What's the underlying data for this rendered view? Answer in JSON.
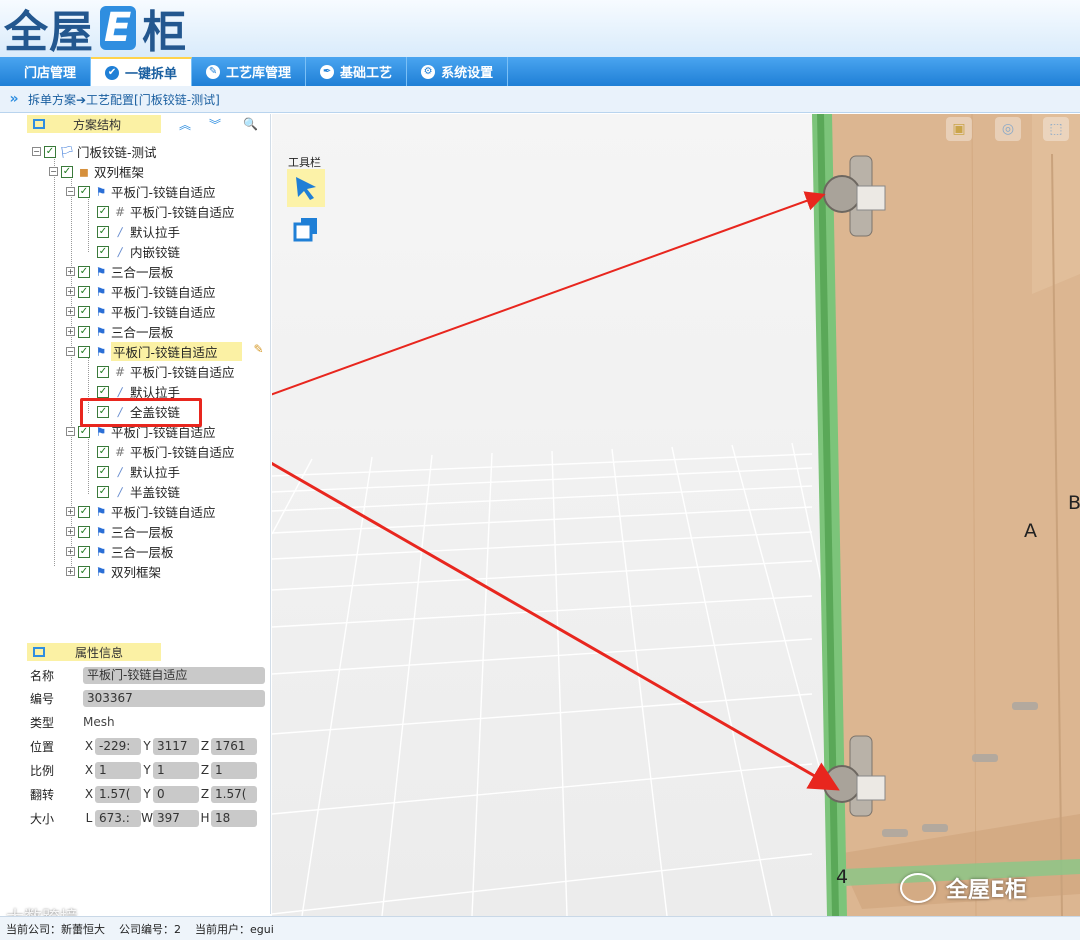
{
  "app": {
    "logo_main": "全屋",
    "logo_e": "E",
    "logo_end": "柜"
  },
  "nav": {
    "tabs": [
      {
        "label": "门店管理",
        "icon": ""
      },
      {
        "label": "一键拆单",
        "icon": "check-circle-icon",
        "active": true
      },
      {
        "label": "工艺库管理",
        "icon": "pencil-icon"
      },
      {
        "label": "基础工艺",
        "icon": "pen-nib-icon"
      },
      {
        "label": "系统设置",
        "icon": "settings-icon"
      }
    ]
  },
  "breadcrumb": {
    "toggle": "»",
    "path": "拆单方案➔工艺配置[门板铰链-测试]"
  },
  "structure_panel": {
    "title": "方案结构"
  },
  "tree": [
    {
      "label": "门板铰链-测试",
      "icon": "flag-icon"
    },
    {
      "label": "双列框架",
      "icon": "box-icon"
    },
    {
      "label": "平板门-铰链自适应",
      "icon": "flag-icon"
    },
    {
      "label": "平板门-铰链自适应",
      "icon": "grid-icon"
    },
    {
      "label": "默认拉手",
      "icon": "handle-icon"
    },
    {
      "label": "内嵌铰链",
      "icon": "hinge-icon"
    },
    {
      "label": "三合一层板",
      "icon": "flag-icon"
    },
    {
      "label": "平板门-铰链自适应",
      "icon": "flag-icon"
    },
    {
      "label": "平板门-铰链自适应",
      "icon": "flag-icon"
    },
    {
      "label": "三合一层板",
      "icon": "flag-icon"
    },
    {
      "label": "平板门-铰链自适应",
      "icon": "flag-icon",
      "selected": true
    },
    {
      "label": "平板门-铰链自适应",
      "icon": "grid-icon"
    },
    {
      "label": "默认拉手",
      "icon": "handle-icon"
    },
    {
      "label": "全盖铰链",
      "icon": "hinge-icon",
      "highlighted": true
    },
    {
      "label": "平板门-铰链自适应",
      "icon": "flag-icon"
    },
    {
      "label": "平板门-铰链自适应",
      "icon": "grid-icon"
    },
    {
      "label": "默认拉手",
      "icon": "handle-icon"
    },
    {
      "label": "半盖铰链",
      "icon": "hinge-icon"
    },
    {
      "label": "平板门-铰链自适应",
      "icon": "flag-icon"
    },
    {
      "label": "三合一层板",
      "icon": "flag-icon"
    },
    {
      "label": "三合一层板",
      "icon": "flag-icon"
    },
    {
      "label": "双列框架",
      "icon": "flag-icon"
    }
  ],
  "properties_panel": {
    "title": "属性信息",
    "name_label": "名称",
    "name": "平板门-铰链自适应",
    "id_label": "编号",
    "id": "303367",
    "type_label": "类型",
    "type": "Mesh",
    "pos_label": "位置",
    "pos_x": "-229:",
    "pos_y": "3117",
    "pos_z": "1761",
    "scale_label": "比例",
    "scale_x": "1",
    "scale_y": "1",
    "scale_z": "1",
    "rot_label": "翻转",
    "rot_x": "1.57(",
    "rot_y": "0",
    "rot_z": "1.57(",
    "size_label": "大小",
    "size_l": "673.:",
    "size_w": "397",
    "size_h": "18",
    "axes": {
      "x": "X",
      "y": "Y",
      "z": "Z",
      "l": "L",
      "w": "W",
      "h": "H"
    }
  },
  "viewport": {
    "toolbar_label": "工具栏",
    "label_a": "A",
    "label_b": "B",
    "label_4": "4"
  },
  "status": {
    "company": "当前公司：新蕾恒大",
    "company_id": "公司编号：2",
    "user": "当前用户：egui"
  },
  "watermark": {
    "text": "全屋E柜",
    "corner": "大数跨境"
  },
  "colors": {
    "nav": "#1f7fd6",
    "highlight": "#fbf1a4",
    "cabinet": "#dcb691",
    "panel_edge": "#7cc47a",
    "annotation": "#e8261e"
  }
}
